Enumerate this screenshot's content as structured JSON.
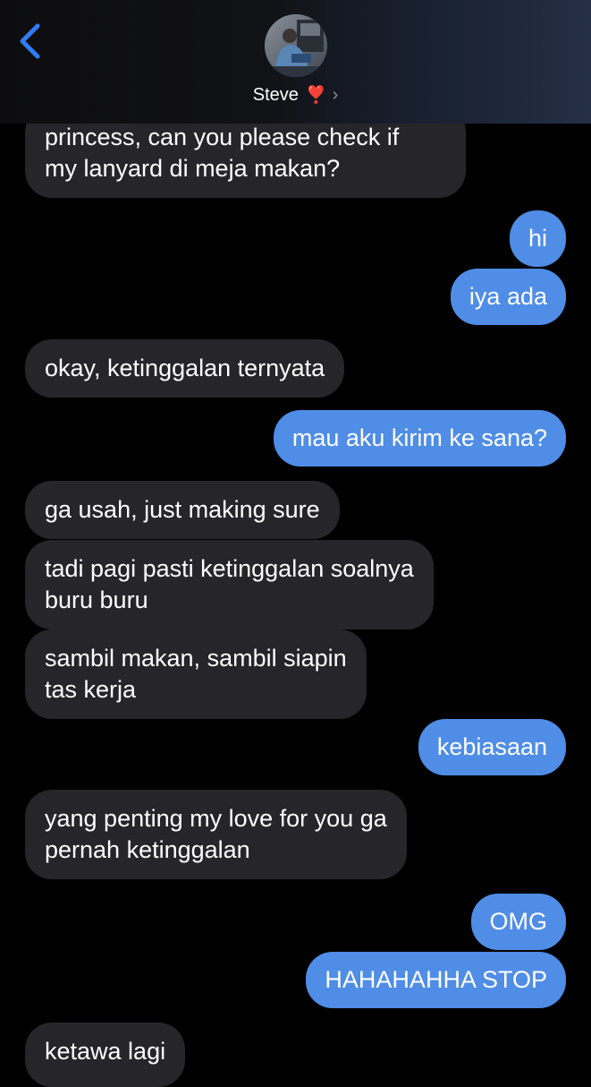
{
  "header": {
    "contact_name": "Steve",
    "heart": "❣️",
    "chevron": "›",
    "back_icon": "chevron-left-icon",
    "accent_color": "#2f7cf6"
  },
  "messages": [
    {
      "side": "received",
      "lines": [
        "princess, can you please check if",
        "my lanyard di meja makan?"
      ]
    },
    {
      "side": "sent",
      "lines": [
        "hi"
      ]
    },
    {
      "side": "sent",
      "lines": [
        "iya ada"
      ]
    },
    {
      "side": "received",
      "lines": [
        "okay, ketinggalan ternyata"
      ]
    },
    {
      "side": "sent",
      "lines": [
        "mau aku kirim ke sana?"
      ]
    },
    {
      "side": "received",
      "lines": [
        "ga usah, just making sure"
      ]
    },
    {
      "side": "received",
      "lines": [
        "tadi pagi pasti ketinggalan soalnya",
        "buru buru"
      ]
    },
    {
      "side": "received",
      "lines": [
        "sambil makan, sambil siapin",
        "tas kerja"
      ]
    },
    {
      "side": "sent",
      "lines": [
        "kebiasaan"
      ]
    },
    {
      "side": "received",
      "lines": [
        "yang penting my love for you ga",
        "pernah ketinggalan"
      ]
    },
    {
      "side": "sent",
      "lines": [
        "OMG"
      ]
    },
    {
      "side": "sent",
      "lines": [
        "HAHAHAHHA STOP"
      ]
    },
    {
      "side": "received",
      "lines": [
        "ketawa lagi"
      ]
    }
  ],
  "colors": {
    "sent_bubble": "#4f8de6",
    "received_bubble": "#26262a",
    "background": "#000000"
  }
}
